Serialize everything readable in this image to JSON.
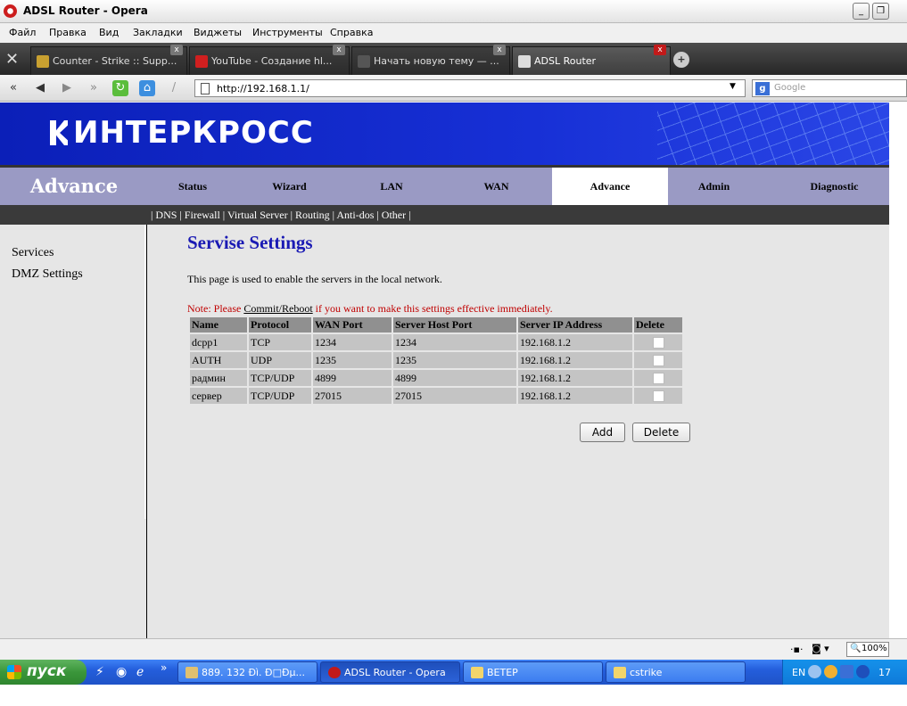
{
  "window": {
    "title": "ADSL Router - Opera"
  },
  "menu": [
    "Файл",
    "Правка",
    "Вид",
    "Закладки",
    "Виджеты",
    "Инструменты",
    "Справка"
  ],
  "tabs": [
    {
      "label": "Counter - Strike :: Supp...",
      "active": false
    },
    {
      "label": "YouTube - Создание hl...",
      "active": false
    },
    {
      "label": "Начать новую тему — ...",
      "active": false
    },
    {
      "label": "ADSL Router",
      "active": true
    }
  ],
  "address": {
    "url": "http://192.168.1.1/",
    "search_placeholder": "Google"
  },
  "router": {
    "logo": "ИНТЕРКРОСС",
    "brand": "Advance",
    "nav": [
      "Status",
      "Wizard",
      "LAN",
      "WAN",
      "Advance",
      "Admin",
      "Diagnostic"
    ],
    "active_nav": "Advance",
    "subnav": "| DNS | Firewall | Virtual Server | Routing | Anti-dos | Other |",
    "sidebar": [
      "Services",
      "DMZ Settings"
    ],
    "heading": "Servise Settings",
    "description": "This page is used to enable the servers in the local network.",
    "note_prefix": "Note: Please ",
    "note_link": "Commit/Reboot",
    "note_suffix": " if you want to make this settings effective immediately.",
    "table": {
      "headers": [
        "Name",
        "Protocol",
        "WAN Port",
        "Server Host Port",
        "Server IP Address",
        "Delete"
      ],
      "rows": [
        [
          "dcpp1",
          "TCP",
          "1234",
          "1234",
          "192.168.1.2"
        ],
        [
          "AUTH",
          "UDP",
          "1235",
          "1235",
          "192.168.1.2"
        ],
        [
          "радмин",
          "TCP/UDP",
          "4899",
          "4899",
          "192.168.1.2"
        ],
        [
          "сервер",
          "TCP/UDP",
          "27015",
          "27015",
          "192.168.1.2"
        ]
      ]
    },
    "buttons": {
      "add": "Add",
      "delete": "Delete"
    }
  },
  "statusbar": {
    "zoom": "100%"
  },
  "taskbar": {
    "start": "пуск",
    "tasks": [
      {
        "label": "889. 132 Ðì. Ð□Ðµ...",
        "active": false
      },
      {
        "label": "ADSL Router - Opera",
        "active": true
      },
      {
        "label": "ВЕТЕР",
        "active": false
      },
      {
        "label": "cstrike",
        "active": false
      }
    ],
    "lang": "EN",
    "clock": "17"
  },
  "colors": {
    "banner": "#1730d6",
    "nav": "#9a9ac4",
    "heading": "#1a1ab4",
    "note": "#c00000"
  }
}
